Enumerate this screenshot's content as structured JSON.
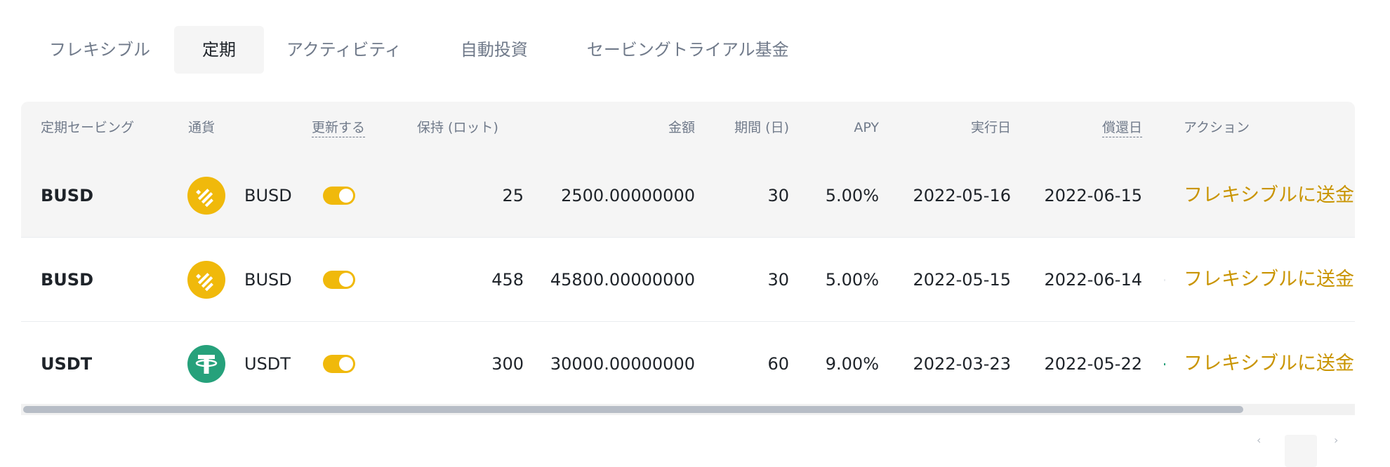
{
  "tabs": [
    {
      "label": "フレキシブル",
      "active": false
    },
    {
      "label": "定期",
      "active": true
    },
    {
      "label": "アクティビティ",
      "active": false
    },
    {
      "label": "自動投資",
      "active": false
    },
    {
      "label": "セービングトライアル基金",
      "active": false
    }
  ],
  "table": {
    "headers": {
      "product": "定期セービング",
      "currency": "通貨",
      "auto_renew": "更新する",
      "lots": "保持 (ロット)",
      "amount": "金額",
      "duration": "期間 (日)",
      "apy": "APY",
      "value_date": "実行日",
      "redemption_date": "償還日",
      "action": "アクション"
    },
    "rows": [
      {
        "product": "BUSD",
        "currency": "BUSD",
        "icon": "busd-icon",
        "auto_renew": true,
        "lots": "25",
        "amount": "2500.00000000",
        "duration": "30",
        "apy": "5.00%",
        "value_date": "2022-05-16",
        "redemption_date": "2022-06-15",
        "action": "フレキシブルに送金"
      },
      {
        "product": "BUSD",
        "currency": "BUSD",
        "icon": "busd-icon",
        "auto_renew": true,
        "lots": "458",
        "amount": "45800.00000000",
        "duration": "30",
        "apy": "5.00%",
        "value_date": "2022-05-15",
        "redemption_date": "2022-06-14",
        "action": "フレキシブルに送金"
      },
      {
        "product": "USDT",
        "currency": "USDT",
        "icon": "usdt-icon",
        "auto_renew": true,
        "lots": "300",
        "amount": "30000.00000000",
        "duration": "60",
        "apy": "9.00%",
        "value_date": "2022-03-23",
        "redemption_date": "2022-05-22",
        "action": "フレキシブルに送金"
      }
    ]
  },
  "colors": {
    "accent": "#c99400",
    "toggle_on": "#f0b90b",
    "busd": "#f0b90b",
    "usdt": "#26a17b",
    "text_primary": "#1e2329",
    "text_secondary": "#707a8a"
  }
}
